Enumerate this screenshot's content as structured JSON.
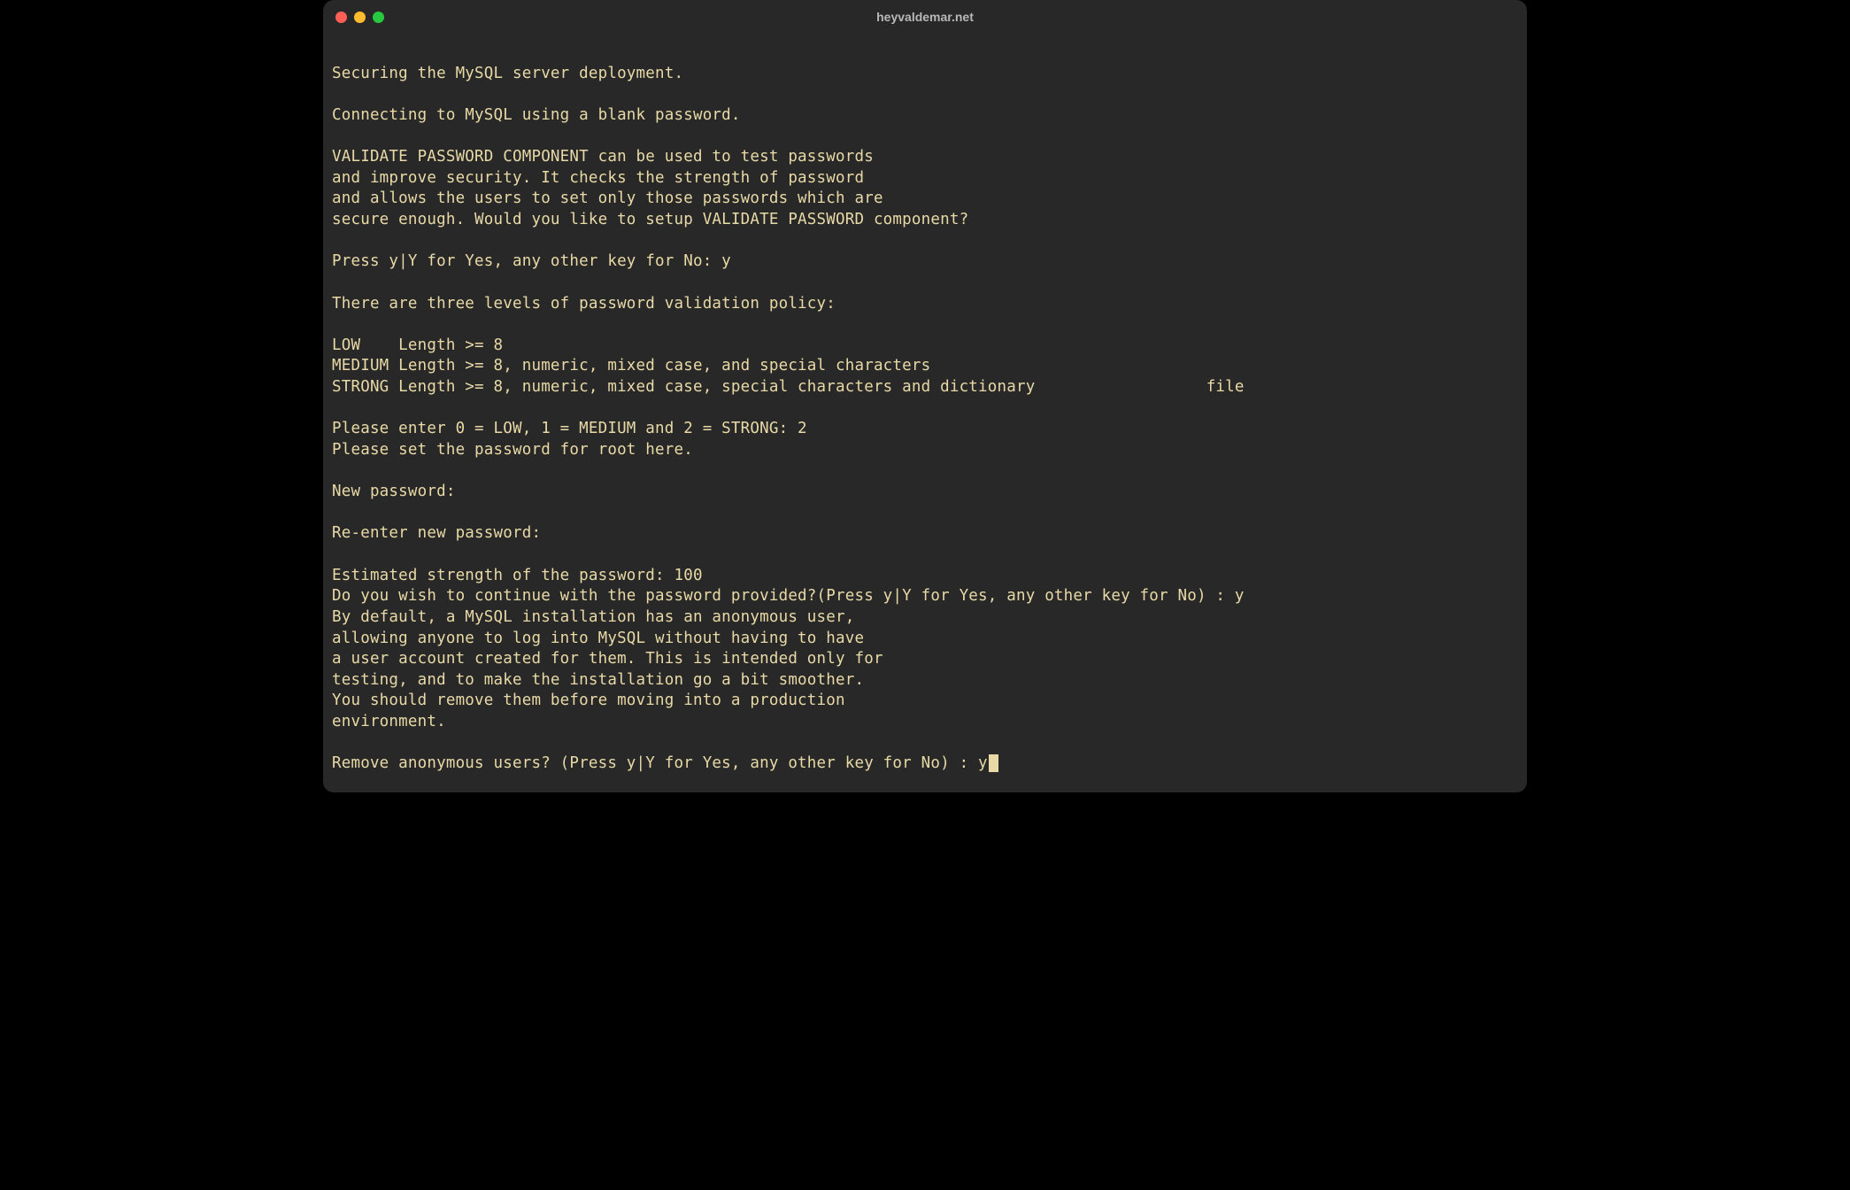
{
  "window": {
    "title": "heyvaldemar.net"
  },
  "terminal": {
    "lines": [
      "",
      "Securing the MySQL server deployment.",
      "",
      "Connecting to MySQL using a blank password.",
      "",
      "VALIDATE PASSWORD COMPONENT can be used to test passwords",
      "and improve security. It checks the strength of password",
      "and allows the users to set only those passwords which are",
      "secure enough. Would you like to setup VALIDATE PASSWORD component?",
      "",
      "Press y|Y for Yes, any other key for No: y",
      "",
      "There are three levels of password validation policy:",
      "",
      "LOW    Length >= 8",
      "MEDIUM Length >= 8, numeric, mixed case, and special characters",
      "STRONG Length >= 8, numeric, mixed case, special characters and dictionary                  file",
      "",
      "Please enter 0 = LOW, 1 = MEDIUM and 2 = STRONG: 2",
      "Please set the password for root here.",
      "",
      "New password:",
      "",
      "Re-enter new password:",
      "",
      "Estimated strength of the password: 100",
      "Do you wish to continue with the password provided?(Press y|Y for Yes, any other key for No) : y",
      "By default, a MySQL installation has an anonymous user,",
      "allowing anyone to log into MySQL without having to have",
      "a user account created for them. This is intended only for",
      "testing, and to make the installation go a bit smoother.",
      "You should remove them before moving into a production",
      "environment.",
      "",
      "Remove anonymous users? (Press y|Y for Yes, any other key for No) : y"
    ]
  }
}
